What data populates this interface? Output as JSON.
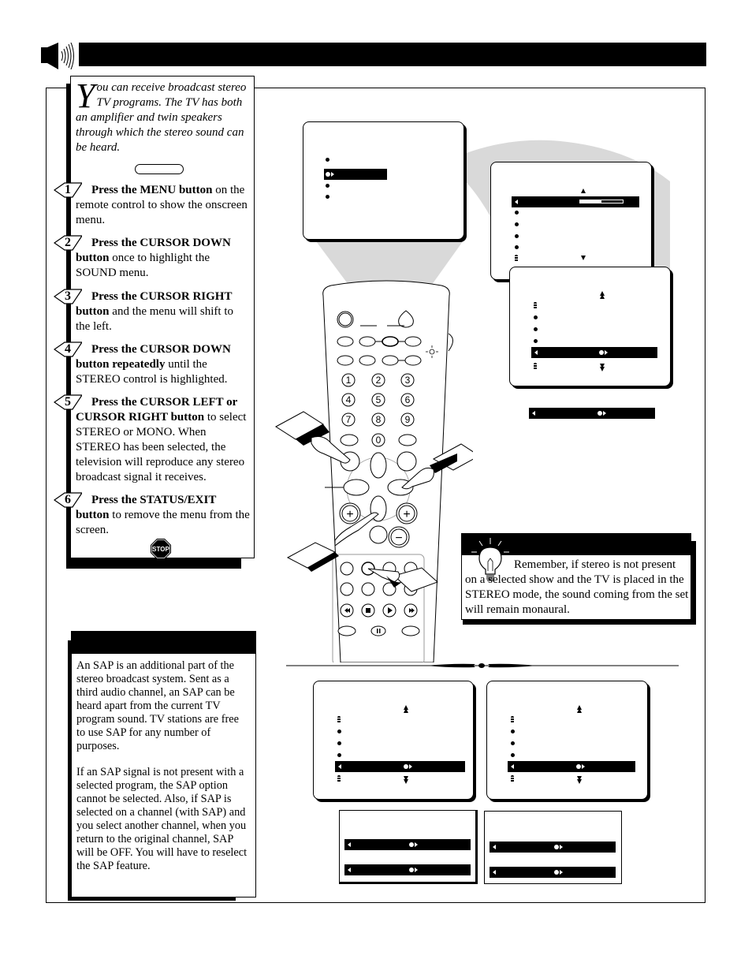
{
  "header": {
    "icon": "speaker-sound-icon",
    "title": ""
  },
  "intro": {
    "dropcap": "Y",
    "text": "ou can receive broadcast stereo TV programs.  The TV has both an amplifier and twin speakers through which the stereo sound can be heard."
  },
  "steps": [
    {
      "num": "1",
      "lead": "Press the MENU button",
      "rest": " on the remote control to show the onscreen menu."
    },
    {
      "num": "2",
      "lead": "Press the CURSOR DOWN button",
      "rest": " once to highlight the SOUND menu."
    },
    {
      "num": "3",
      "lead": "Press the CURSOR RIGHT button",
      "rest": " and the menu will shift to the left."
    },
    {
      "num": "4",
      "lead": "Press the CURSOR DOWN button repeatedly",
      "rest": " until the STEREO control is highlighted."
    },
    {
      "num": "5",
      "lead": "Press the CURSOR LEFT or CURSOR RIGHT button",
      "rest": " to select STEREO or MONO.  When STEREO has been selected, the television will reproduce any stereo broadcast signal it receives."
    },
    {
      "num": "6",
      "lead": "Press the STATUS/EXIT button",
      "rest": " to remove the menu from the screen."
    }
  ],
  "stop_sign": "STOP",
  "sap": {
    "title": "",
    "paragraphs": [
      "An SAP is an additional part of the stereo broadcast system.  Sent as a third audio channel, an SAP can be heard apart from the current TV program sound.  TV stations are free to use SAP for any number of purposes.",
      "If an SAP signal is not present with a selected program, the SAP option cannot be selected.  Also, if SAP is selected on a channel (with SAP) and you select another channel, when you return to the original channel, SAP will be OFF.  You will have to reselect the SAP feature."
    ]
  },
  "tip": {
    "title": "",
    "icon": "lightbulb-icon",
    "text": "Remember, if stereo is not present on a selected show and the TV is placed in the STEREO mode, the sound coming from the set will remain monaural."
  },
  "remote": {
    "number_keys": [
      "1",
      "2",
      "3",
      "4",
      "5",
      "6",
      "7",
      "8",
      "9",
      "0"
    ],
    "volume_plus": "+",
    "channel_plus": "+",
    "channel_minus": "−"
  },
  "screens": {
    "main_menu": {
      "items": 4,
      "highlighted_index": 1
    },
    "sound_menu_1": {
      "slider_value": 0.5,
      "items": 6,
      "highlighted_index": 0
    },
    "sound_menu_2": {
      "items": 6,
      "highlighted_index": 4
    },
    "stereo_bar": {
      "items": 1
    },
    "sap_menu_left": {
      "items": 6,
      "highlighted_index": 4
    },
    "sap_menu_right": {
      "items": 6,
      "highlighted_index": 4
    },
    "sap_options_left": {
      "items": 2
    },
    "sap_options_right": {
      "items": 2
    }
  }
}
